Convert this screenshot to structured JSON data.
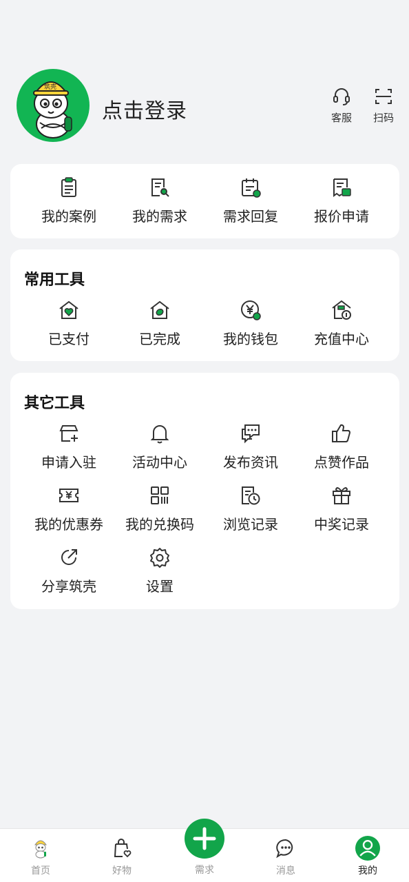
{
  "header": {
    "login_text": "点击登录",
    "service_label": "客服",
    "scan_label": "扫码",
    "avatar_hat_text": "筑壳"
  },
  "quick": {
    "items": [
      {
        "label": "我的案例",
        "icon": "clipboard-icon"
      },
      {
        "label": "我的需求",
        "icon": "document-search-icon"
      },
      {
        "label": "需求回复",
        "icon": "calendar-reply-icon"
      },
      {
        "label": "报价申请",
        "icon": "receipt-icon"
      }
    ]
  },
  "common_tools": {
    "title": "常用工具",
    "items": [
      {
        "label": "已支付",
        "icon": "house-heart-icon"
      },
      {
        "label": "已完成",
        "icon": "house-leaf-icon"
      },
      {
        "label": "我的钱包",
        "icon": "yuan-coin-icon"
      },
      {
        "label": "充值中心",
        "icon": "house-coin-icon"
      }
    ]
  },
  "other_tools": {
    "title": "其它工具",
    "items": [
      {
        "label": "申请入驻",
        "icon": "store-add-icon"
      },
      {
        "label": "活动中心",
        "icon": "bell-icon"
      },
      {
        "label": "发布资讯",
        "icon": "chat-bubbles-icon"
      },
      {
        "label": "点赞作品",
        "icon": "thumbs-up-icon"
      },
      {
        "label": "我的优惠券",
        "icon": "coupon-icon"
      },
      {
        "label": "我的兑换码",
        "icon": "qr-code-icon"
      },
      {
        "label": "浏览记录",
        "icon": "history-icon"
      },
      {
        "label": "中奖记录",
        "icon": "gift-icon"
      },
      {
        "label": "分享筑壳",
        "icon": "share-icon"
      },
      {
        "label": "设置",
        "icon": "gear-icon"
      }
    ]
  },
  "tabbar": {
    "tabs": [
      {
        "label": "首页",
        "icon": "mascot-home-icon"
      },
      {
        "label": "好物",
        "icon": "shopping-bag-icon"
      },
      {
        "label": "需求",
        "icon": "plus-icon"
      },
      {
        "label": "消息",
        "icon": "message-icon"
      },
      {
        "label": "我的",
        "icon": "profile-icon"
      }
    ],
    "active": "我的"
  },
  "colors": {
    "brand_green": "#12a54a",
    "avatar_green": "#12b553",
    "background": "#f2f3f5",
    "text": "#222222",
    "inactive_tab": "#999999"
  }
}
